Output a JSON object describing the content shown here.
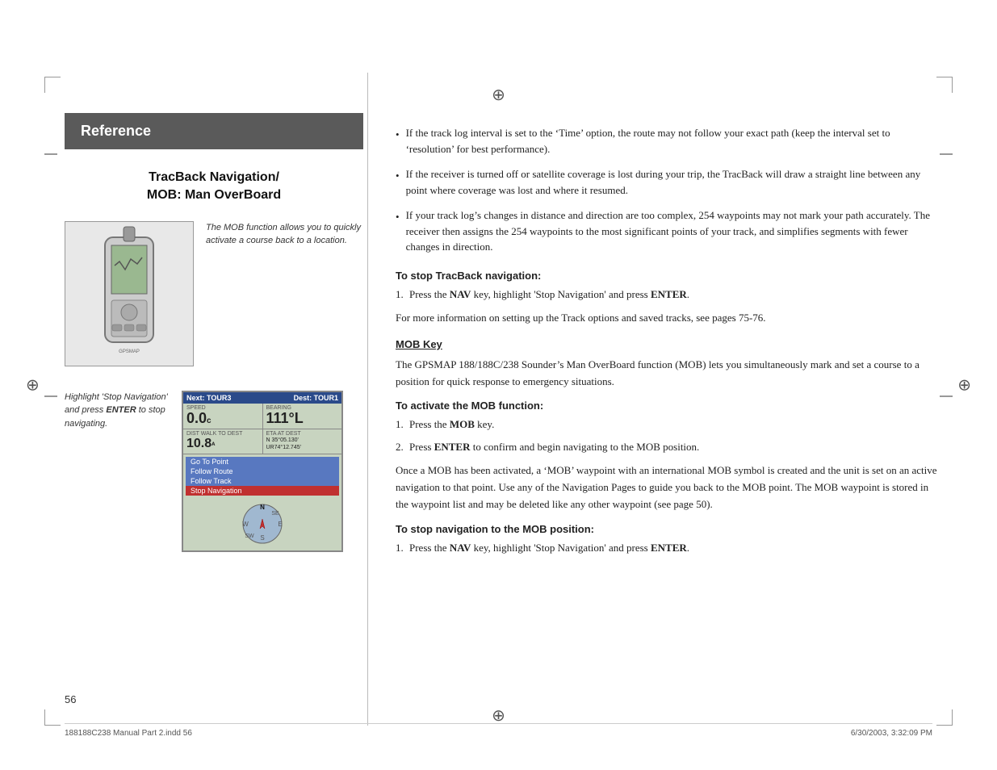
{
  "page": {
    "number": "56",
    "footer_left": "188188C238 Manual Part 2.indd   56",
    "footer_right": "6/30/2003, 3:32:09 PM"
  },
  "reference_banner": {
    "label": "Reference"
  },
  "section_title": "TracBack Navigation/\nMOB: Man OverBoard",
  "device1": {
    "caption": "The MOB function allows you to quickly activate a course back to a location."
  },
  "device2": {
    "caption": "Highlight 'Stop Navigation' and press ENTER to stop navigating."
  },
  "gps_screen": {
    "header_left": "Next: TOUR3",
    "header_right": "Dest: TOUR1",
    "label1": "SPEED",
    "value1": "0.0ᴄ",
    "label2": "BEARING",
    "value2": "111°L",
    "label3": "DIST WALK TO DEST",
    "value3": "10.8ᴁ",
    "label4": "ETA AT DEST",
    "value4": "N 35°05.130'\nUR74°12.745'",
    "menu_items": [
      "Go To Point",
      "Follow Route",
      "Follow Track",
      "Stop Navigation"
    ]
  },
  "right_col": {
    "bullets": [
      "If the track log interval is set to the ‘Time’ option, the route may not follow your exact path (keep the interval set to ‘resolution’ for best performance).",
      "If the receiver is turned off or satellite coverage is lost during your trip, the TracBack will draw a straight line between any point where coverage was lost and where it resumed.",
      "If your track log’s changes in distance and direction are too complex, 254 waypoints may not mark your path accurately. The receiver then assigns the 254 waypoints to the most significant points of your track, and simplifies segments with fewer changes in direction."
    ],
    "stop_tracback_header": "To stop TracBack navigation:",
    "stop_tracback_step1": "Press the NAV key, highlight ‘Stop Navigation’ and press ENTER.",
    "more_info_note": "For more information on setting up the Track options and saved tracks, see pages 75-76.",
    "mob_key_header": "MOB Key",
    "mob_key_para": "The GPSMAP 188/188C/238 Sounder’s Man OverBoard function (MOB) lets you simultaneously mark and set a course to a position for quick response to emergency situations.",
    "activate_mob_header": "To activate the MOB function:",
    "activate_mob_step1": "Press the MOB key.",
    "activate_mob_step2": "Press ENTER to confirm and begin navigating to the MOB position.",
    "mob_activated_para": "Once a MOB has been activated, a ‘MOB’ waypoint with an international MOB symbol is created and the unit is set on an active navigation to that point. Use any of the Navigation Pages to guide you back to the MOB point. The MOB waypoint is stored in the waypoint list and may be deleted like any other waypoint (see page 50).",
    "stop_mob_header": "To stop navigation to the MOB position:",
    "stop_mob_step1": "Press the NAV key, highlight ‘Stop Navigation’ and press ENTER."
  }
}
